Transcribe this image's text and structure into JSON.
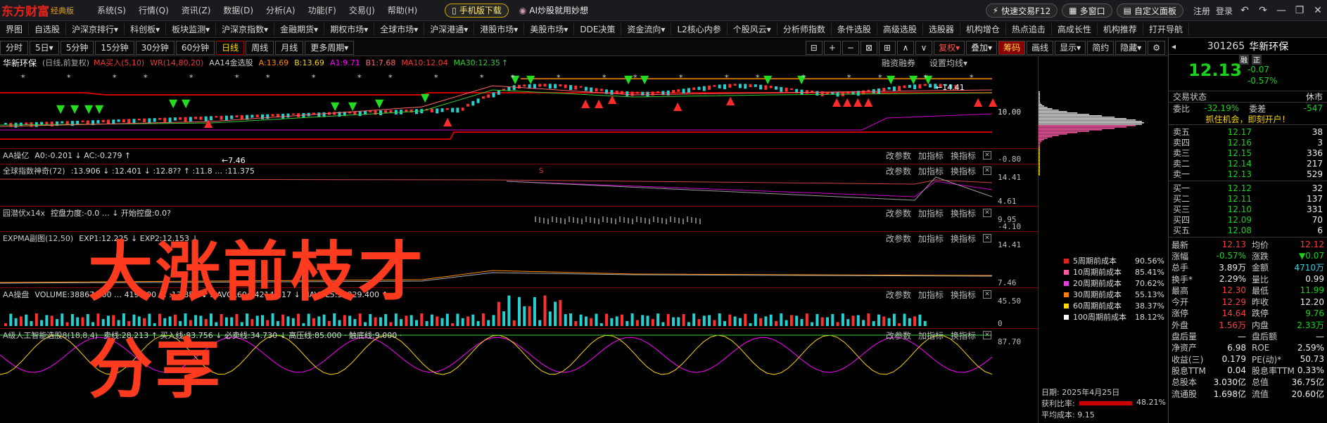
{
  "app": {
    "logo": "东方财富",
    "edition": "经典版",
    "menus": [
      "系统(S)",
      "行情(Q)",
      "资讯(Z)",
      "数据(D)",
      "分析(A)",
      "功能(F)",
      "交易(J)",
      "帮助(H)"
    ],
    "mobile_btn": "手机版下载",
    "ai_btn": "AI炒股就用妙想",
    "quick_trade": "快速交易F12",
    "multi_window": "多窗口",
    "custom_panel": "自定义面板",
    "login": "注册",
    "login2": "登录"
  },
  "nav": {
    "items": [
      "界图",
      "自选股",
      "沪深京排行▾",
      "科创板▾",
      "板块监测▾",
      "沪深京指数▾",
      "金融期货▾",
      "期权市场▾",
      "全球市场▾",
      "沪深港通▾",
      "港股市场▾",
      "美股市场▾",
      "DDE决策",
      "资金流向▾",
      "L2核心内参",
      "个股风云▾",
      "分析师指数",
      "条件选股",
      "高级选股",
      "选股器",
      "机构增仓",
      "热点追击",
      "高成长性",
      "机构推荐",
      "打开导航"
    ]
  },
  "periods": {
    "items": [
      "分时",
      "5日▾",
      "5分钟",
      "15分钟",
      "30分钟",
      "60分钟",
      "日线",
      "周线",
      "月线",
      "更多周期▾"
    ],
    "active": "日线"
  },
  "tools": {
    "items": [
      "⊟",
      "+",
      "−",
      "⊠",
      "⊞",
      "∧",
      "∨"
    ],
    "fq": "复权▾",
    "add": "叠加▾",
    "chip": "筹码",
    "draw": "画线",
    "show": "显示▾",
    "simple": "简约",
    "hide": "隐藏▾"
  },
  "main": {
    "name": "华新环保",
    "desc": "(日线,前复权)",
    "ma_label": "MA买入(5,10)",
    "wr_label": "WR(14,80,20)",
    "aa14": "AA14金选股",
    "a": "A:13.69",
    "b": "B:13.69",
    "a1": "A1:9.71",
    "b1": "B1:7.68",
    "ma10": "MA10:12.04",
    "ma30": "MA30:12.35",
    "rongzi": "融资融券",
    "setting": "设置均线▾",
    "high_label": "14.41",
    "low_label": "7.46",
    "scale_mid": "10.00",
    "scale_low": "-0.80",
    "s_mark": "S"
  },
  "panes": [
    {
      "name": "AA操亿",
      "vals": "A0:-0.201 ↓ AC:-0.279 ↑",
      "scale_top": "",
      "scale_bot": "-0.80"
    },
    {
      "name": "全球指数神奇(72)",
      "vals": ":13.906 ↓ :12.401 ↓ :12.8?? ↑ :11.8 … :11.375",
      "scale_top": "14.41",
      "scale_bot": "4.61"
    },
    {
      "name": "园潜伏x14x",
      "vals": "控盘力度:-0.0 … ↓ 开始控盘:0.0?",
      "scale_top": "9.95",
      "scale_bot": "-4.10"
    },
    {
      "name": "EXPMA副图(12,50)",
      "vals": "EXP1:12.225 ↓ EXP2:12.153 ↓",
      "scale_top": "14.41",
      "scale_bot": "7.46"
    },
    {
      "name": "AA操盘",
      "vals": "VOLUME:38867.000 … 419.400 … :13.850 ↓ MAVOL60:74214.117 ↓ MAVOL5:39829.400 ↑",
      "scale_top": "45.50",
      "scale_bot": "0"
    },
    {
      "name": "A级人工智能选股8(18,8,4)",
      "vals": "卖线:28.213 ↑ 买入线:83.756 ↓ 必卖线:34.730 ↓ 高压线:85.000 · 触底线:9.000 ·",
      "scale_top": "87.70",
      "scale_bot": ""
    }
  ],
  "pane_ops": {
    "change": "改参数",
    "add": "加指标",
    "swap": "换指标"
  },
  "overlay": {
    "line1": "大涨前枝才",
    "line2": "分享"
  },
  "cost": {
    "rows": [
      {
        "label": "5周期前成本",
        "pct": "90.56%",
        "color": "#e02020"
      },
      {
        "label": "10周期前成本",
        "pct": "85.41%",
        "color": "#ff5aa8"
      },
      {
        "label": "20周期前成本",
        "pct": "70.62%",
        "color": "#e040e0"
      },
      {
        "label": "30周期前成本",
        "pct": "55.13%",
        "color": "#ff7f00"
      },
      {
        "label": "60周期前成本",
        "pct": "38.37%",
        "color": "#ffd700"
      },
      {
        "label": "100周期前成本",
        "pct": "18.12%",
        "color": "#ffffff"
      }
    ],
    "date_label": "日期:",
    "date": "2025年4月25日",
    "profit_label": "获利比率:",
    "profit": "48.21%",
    "avg_label": "平均成本:",
    "avg": "9.15"
  },
  "quote": {
    "code": "301265",
    "name": "华新环保",
    "tag1": "融",
    "tag2": "正",
    "price": "12.13",
    "change": "-0.07",
    "change_pct": "-0.57%",
    "trade_state_label": "交易状态",
    "trade_state": "休市",
    "weibi_label": "委比",
    "weibi": "-32.19%",
    "weicha_label": "委差",
    "weicha": "-547",
    "slogan": "抓住机会，即刻开户！",
    "asks": [
      {
        "l": "卖五",
        "p": "12.17",
        "v": "38"
      },
      {
        "l": "卖四",
        "p": "12.16",
        "v": "3"
      },
      {
        "l": "卖三",
        "p": "12.15",
        "v": "336"
      },
      {
        "l": "卖二",
        "p": "12.14",
        "v": "217"
      },
      {
        "l": "卖一",
        "p": "12.13",
        "v": "529"
      }
    ],
    "bids": [
      {
        "l": "买一",
        "p": "12.12",
        "v": "32"
      },
      {
        "l": "买二",
        "p": "12.11",
        "v": "137"
      },
      {
        "l": "买三",
        "p": "12.10",
        "v": "331"
      },
      {
        "l": "买四",
        "p": "12.09",
        "v": "70"
      },
      {
        "l": "买五",
        "p": "12.08",
        "v": "6"
      }
    ],
    "stats": [
      {
        "a": "最新",
        "av": "12.13",
        "ac": "red",
        "b": "均价",
        "bv": "12.12",
        "bc": "red"
      },
      {
        "a": "涨幅",
        "av": "-0.57%",
        "ac": "grn",
        "b": "涨跌",
        "bv": "▼0.07",
        "bc": "grn"
      },
      {
        "a": "总手",
        "av": "3.89万",
        "ac": "wht",
        "b": "金额",
        "bv": "4710万",
        "bc": "cyan"
      },
      {
        "a": "换手*",
        "av": "2.29%",
        "ac": "wht",
        "b": "量比",
        "bv": "0.99",
        "bc": "wht"
      },
      {
        "a": "最高",
        "av": "12.30",
        "ac": "red",
        "b": "最低",
        "bv": "11.99",
        "bc": "grn"
      },
      {
        "a": "今开",
        "av": "12.29",
        "ac": "red",
        "b": "昨收",
        "bv": "12.20",
        "bc": "wht"
      },
      {
        "a": "涨停",
        "av": "14.64",
        "ac": "red",
        "b": "跌停",
        "bv": "9.76",
        "bc": "grn"
      },
      {
        "a": "外盘",
        "av": "1.56万",
        "ac": "red",
        "b": "内盘",
        "bv": "2.33万",
        "bc": "grn"
      },
      {
        "a": "盘后量",
        "av": "—",
        "ac": "wht",
        "b": "盘后额",
        "bv": "—",
        "bc": "wht"
      },
      {
        "a": "净资产",
        "av": "6.98",
        "ac": "wht",
        "b": "ROE",
        "bv": "2.59%",
        "bc": "wht"
      },
      {
        "a": "收益(三)",
        "av": "0.179",
        "ac": "wht",
        "b": "PE(动)*",
        "bv": "50.73",
        "bc": "wht"
      },
      {
        "a": "股息TTM",
        "av": "0.04",
        "ac": "wht",
        "b": "股息率TTM",
        "bv": "0.33%",
        "bc": "wht"
      },
      {
        "a": "总股本",
        "av": "3.030亿",
        "ac": "wht",
        "b": "总值",
        "bv": "36.75亿",
        "bc": "wht"
      },
      {
        "a": "流通股",
        "av": "1.698亿",
        "ac": "wht",
        "b": "流值",
        "bv": "20.60亿",
        "bc": "wht"
      }
    ]
  },
  "colors": {
    "up": "#ff3b3b",
    "down": "#19d219",
    "brand": "#e0241b",
    "bg": "#000000"
  }
}
